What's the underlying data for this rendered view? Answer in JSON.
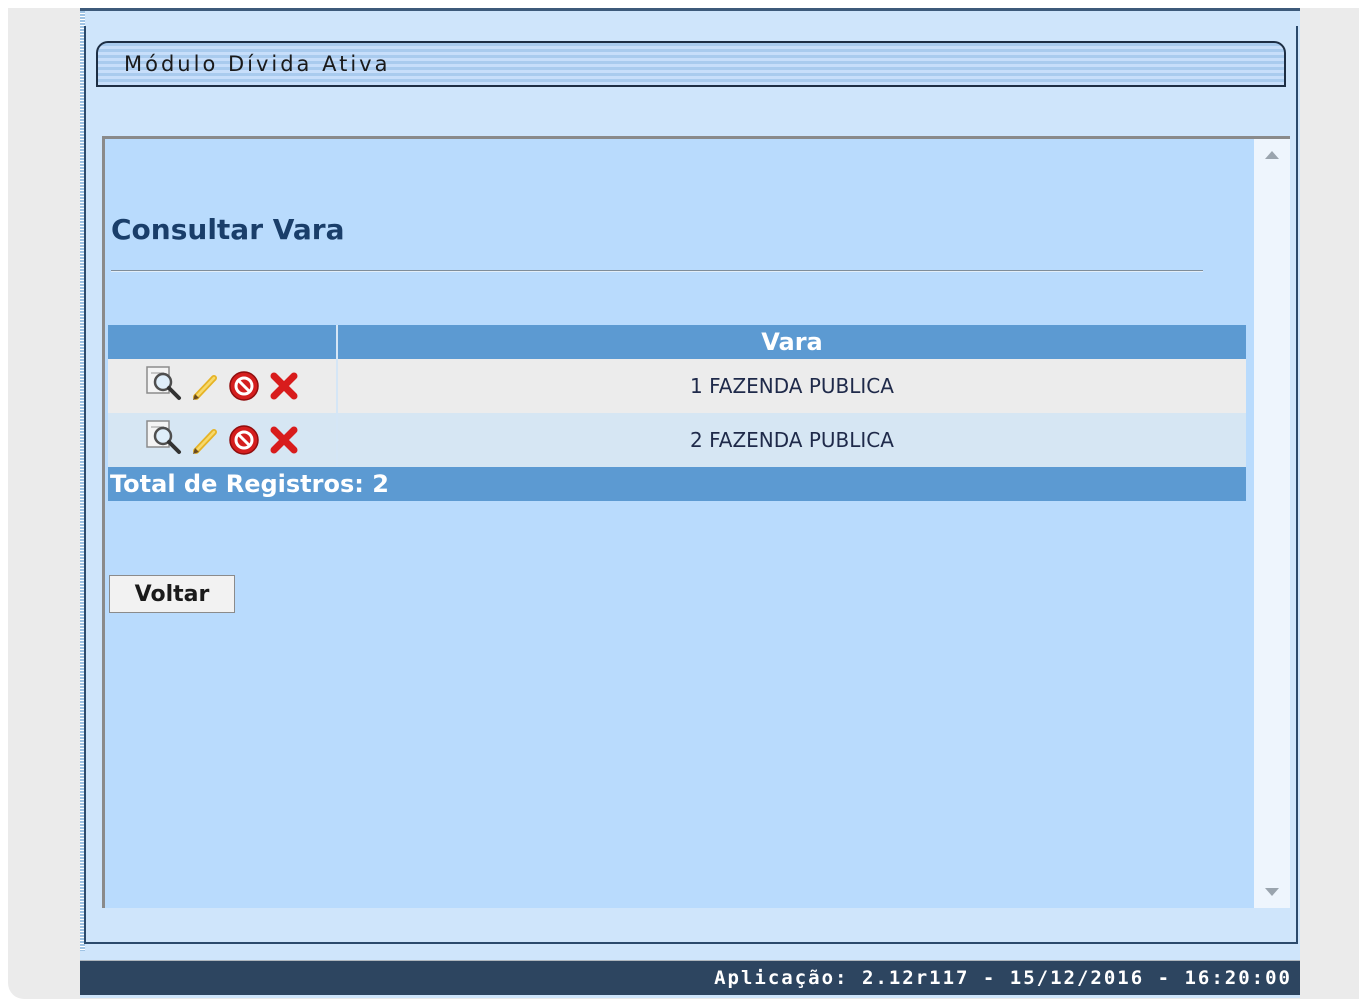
{
  "module": {
    "title": "Módulo Dívida Ativa"
  },
  "page": {
    "title": "Consultar Vara"
  },
  "table": {
    "headers": [
      "",
      "Vara"
    ],
    "rows": [
      {
        "vara": "1 FAZENDA PUBLICA",
        "actions": [
          "view-icon",
          "edit-icon",
          "disable-icon",
          "delete-icon"
        ]
      },
      {
        "vara": "2 FAZENDA PUBLICA",
        "actions": [
          "view-icon",
          "edit-icon",
          "disable-icon",
          "delete-icon"
        ]
      }
    ],
    "total_label": "Total de Registros: 2"
  },
  "buttons": {
    "voltar": "Voltar"
  },
  "footer": {
    "text": "Aplicação: 2.12r117 - 15/12/2016 - 16:20:00"
  },
  "colors": {
    "header_bg": "#5c9ad2",
    "content_bg": "#b9dbfd",
    "title": "#1a3e6a",
    "footer_bg": "#2d4560"
  }
}
